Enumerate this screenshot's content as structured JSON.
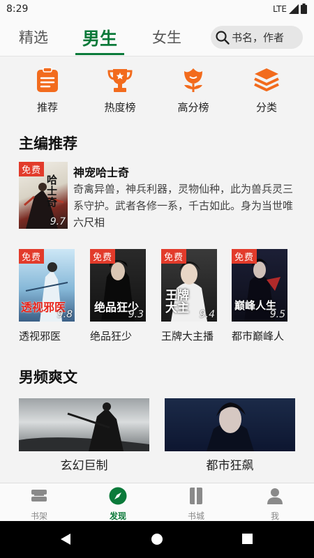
{
  "status": {
    "time": "8:29",
    "network": "LTE"
  },
  "tabs": [
    {
      "label": "精选",
      "active": false
    },
    {
      "label": "男生",
      "active": true
    },
    {
      "label": "女生",
      "active": false
    }
  ],
  "search": {
    "placeholder": "书名，作者"
  },
  "categories": [
    {
      "label": "推荐",
      "icon": "clipboard-icon"
    },
    {
      "label": "热度榜",
      "icon": "trophy-icon"
    },
    {
      "label": "高分榜",
      "icon": "flower-icon"
    },
    {
      "label": "分类",
      "icon": "layers-icon"
    }
  ],
  "editor_pick": {
    "title": "主编推荐",
    "featured": {
      "name": "神宠哈士奇",
      "description": "奇禽异兽，神兵利器，灵物仙种，此为兽兵灵三系守护。武者各修一系，千古如此。身为当世唯",
      "author": "六尺相",
      "score": "9.7",
      "tag": "免费",
      "cover_title": "哈士奇"
    },
    "books": [
      {
        "name": "透视邪医",
        "score": "9.8",
        "tag": "免费",
        "cover_title": "透视邪医"
      },
      {
        "name": "绝品狂少",
        "score": "9.3",
        "tag": "免费",
        "cover_title": "绝品狂少"
      },
      {
        "name": "王牌大主播",
        "score": "9.4",
        "tag": "免费",
        "cover_title": "王牌大主"
      },
      {
        "name": "都市巅峰人",
        "score": "9.5",
        "tag": "免费",
        "cover_title": "巅峰人生"
      }
    ]
  },
  "male_section": {
    "title": "男频爽文",
    "banners": [
      {
        "label": "玄幻巨制"
      },
      {
        "label": "都市狂飙"
      }
    ]
  },
  "bottom_nav": [
    {
      "label": "书架",
      "icon": "bookshelf-icon",
      "active": false
    },
    {
      "label": "发现",
      "icon": "compass-icon",
      "active": true
    },
    {
      "label": "书城",
      "icon": "book-icon",
      "active": false
    },
    {
      "label": "我",
      "icon": "person-icon",
      "active": false
    }
  ],
  "colors": {
    "accent": "#0b7a3a",
    "icon_orange": "#f26b1d",
    "free_tag": "#e23b2b"
  }
}
